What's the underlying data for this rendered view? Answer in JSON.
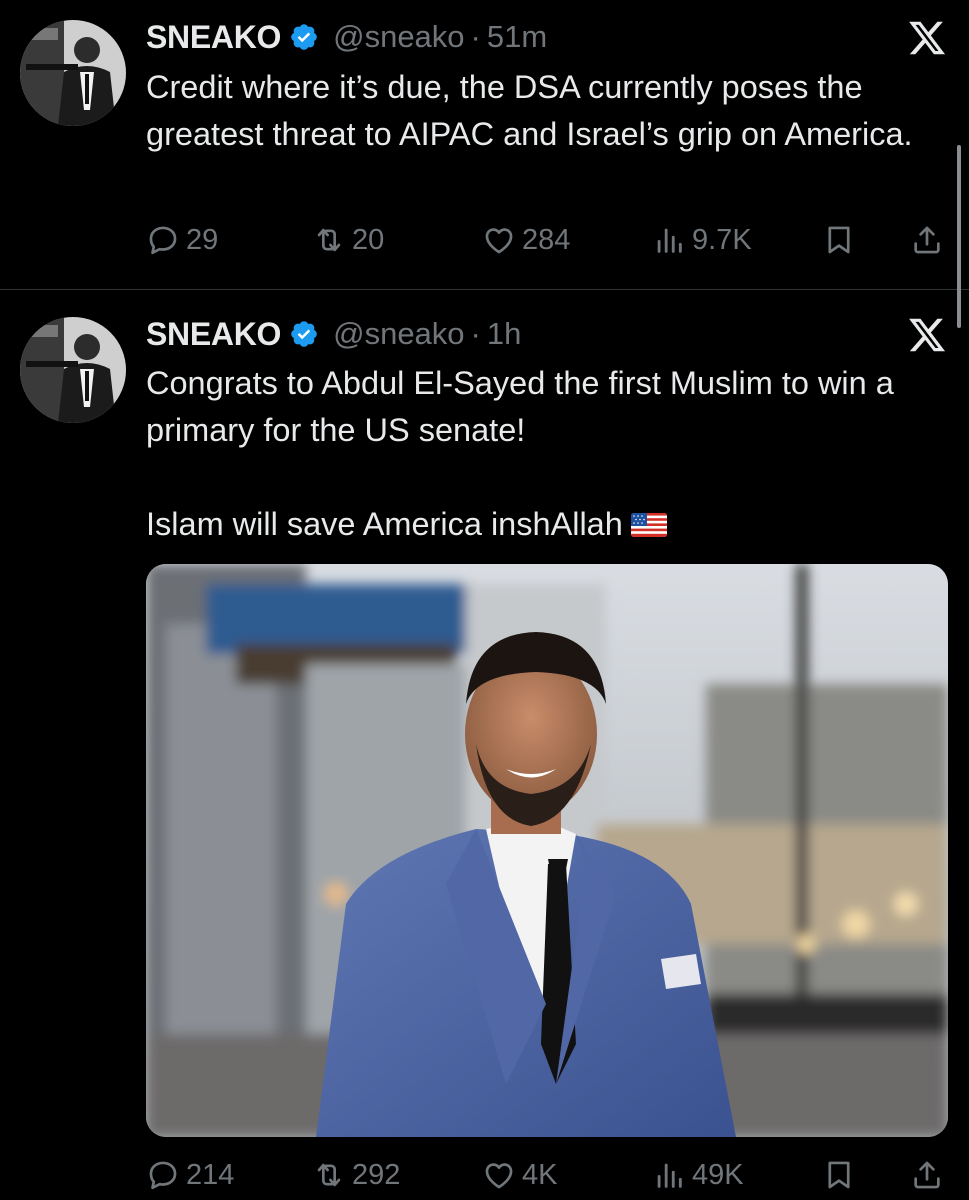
{
  "tweets": [
    {
      "display_name": "SNEAKO",
      "handle": "@sneako",
      "separator": "·",
      "time": "51m",
      "body": [
        "Credit where it’s due, the DSA currently poses the greatest threat to AIPAC and Israel’s grip on America."
      ],
      "stats": {
        "replies": "29",
        "retweets": "20",
        "likes": "284",
        "views": "9.7K"
      }
    },
    {
      "display_name": "SNEAKO",
      "handle": "@sneako",
      "separator": "·",
      "time": "1h",
      "body": [
        "Congrats to Abdul El-Sayed the first Muslim to win a primary for the US senate!",
        "Islam will save America inshAllah"
      ],
      "flag": "🇺🇸",
      "stats": {
        "replies": "214",
        "retweets": "292",
        "likes": "4K",
        "views": "49K"
      }
    }
  ],
  "icons": {
    "verified": "verified-badge-icon",
    "platform": "x-logo-icon",
    "reply": "reply-icon",
    "retweet": "retweet-icon",
    "like": "heart-icon",
    "views": "views-icon",
    "bookmark": "bookmark-icon",
    "share": "share-icon"
  },
  "colors": {
    "background": "#000000",
    "text": "#e7e9ea",
    "muted": "#71767b",
    "verified": "#1d9bf0",
    "divider": "#2f3336"
  }
}
